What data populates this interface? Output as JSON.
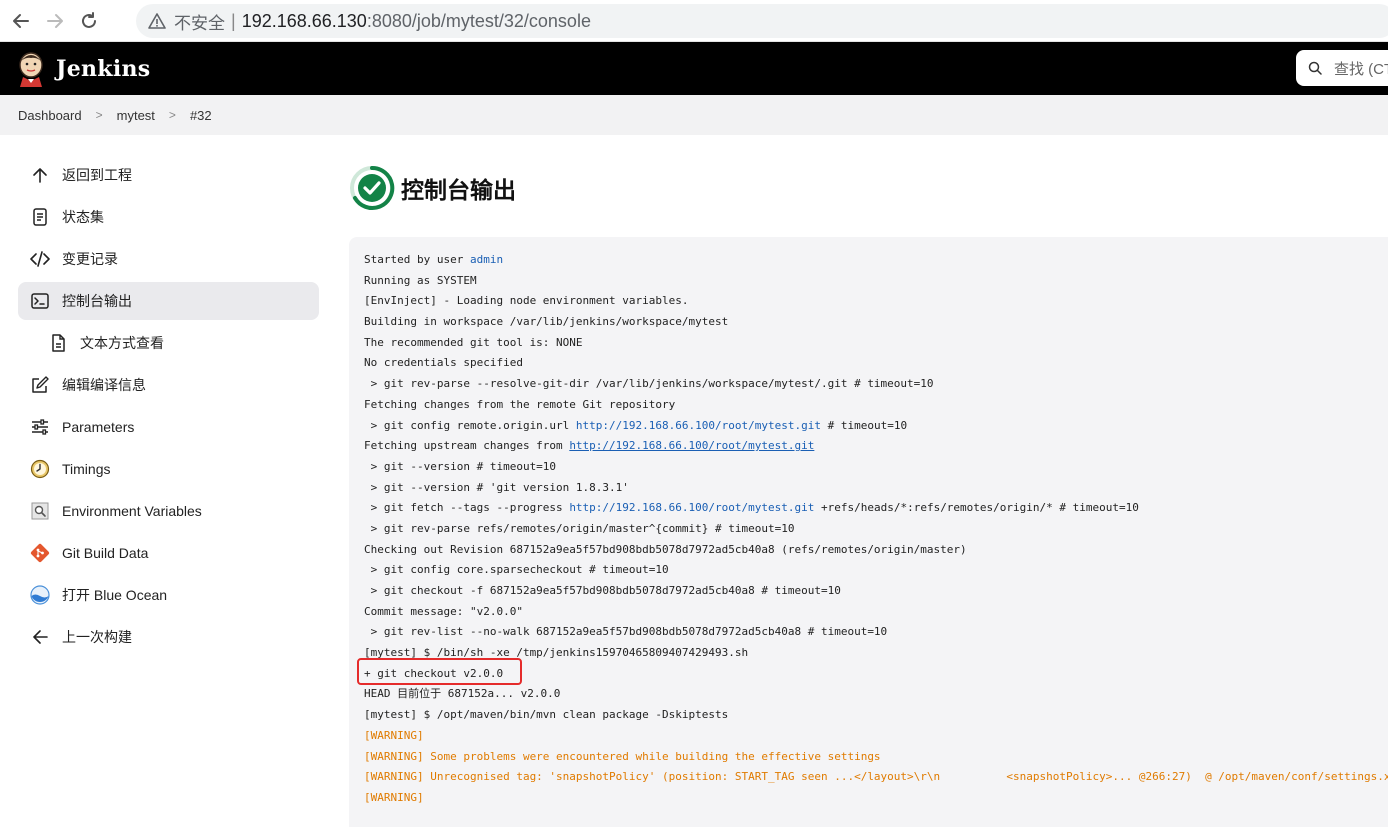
{
  "browser": {
    "back_icon": "back-arrow-icon",
    "forward_icon": "forward-arrow-icon",
    "reload_icon": "reload-icon",
    "security_label": "不安全",
    "separator": "|",
    "url_host": "192.168.66.130",
    "url_rest": ":8080/job/mytest/32/console"
  },
  "header": {
    "title": "Jenkins",
    "search_placeholder": "查找 (CT"
  },
  "breadcrumb": {
    "items": [
      "Dashboard",
      "mytest",
      "#32"
    ]
  },
  "sidebar": {
    "items": [
      {
        "label": "返回到工程",
        "icon": "arrow-up-icon"
      },
      {
        "label": "状态集",
        "icon": "document-icon"
      },
      {
        "label": "变更记录",
        "icon": "code-icon"
      },
      {
        "label": "控制台输出",
        "icon": "terminal-icon"
      },
      {
        "label": "文本方式查看",
        "icon": "file-icon"
      },
      {
        "label": "编辑编译信息",
        "icon": "edit-icon"
      },
      {
        "label": "Parameters",
        "icon": "sliders-icon"
      },
      {
        "label": "Timings",
        "icon": "clock-icon"
      },
      {
        "label": "Environment Variables",
        "icon": "env-icon"
      },
      {
        "label": "Git Build Data",
        "icon": "git-icon"
      },
      {
        "label": "打开 Blue Ocean",
        "icon": "blue-ocean-icon"
      },
      {
        "label": "上一次构建",
        "icon": "arrow-left-icon"
      }
    ]
  },
  "main": {
    "title": "控制台输出",
    "status_icon": "success-check-icon"
  },
  "console": {
    "l1_prefix": "Started by user ",
    "l1_link": "admin",
    "l2": "Running as SYSTEM",
    "l3": "[EnvInject] - Loading node environment variables.",
    "l4": "Building in workspace /var/lib/jenkins/workspace/mytest",
    "l5": "The recommended git tool is: NONE",
    "l6": "No credentials specified",
    "l7": " > git rev-parse --resolve-git-dir /var/lib/jenkins/workspace/mytest/.git # timeout=10",
    "l8": "Fetching changes from the remote Git repository",
    "l9_prefix": " > git config remote.origin.url ",
    "l9_link": "http://192.168.66.100/root/mytest.git",
    "l9_suffix": " # timeout=10",
    "l10_prefix": "Fetching upstream changes from ",
    "l10_link": "http://192.168.66.100/root/mytest.git",
    "l11": " > git --version # timeout=10",
    "l12": " > git --version # 'git version 1.8.3.1'",
    "l13_prefix": " > git fetch --tags --progress ",
    "l13_link": "http://192.168.66.100/root/mytest.git",
    "l13_suffix": " +refs/heads/*:refs/remotes/origin/* # timeout=10",
    "l14": " > git rev-parse refs/remotes/origin/master^{commit} # timeout=10",
    "l15": "Checking out Revision 687152a9ea5f57bd908bdb5078d7972ad5cb40a8 (refs/remotes/origin/master)",
    "l16": " > git config core.sparsecheckout # timeout=10",
    "l17": " > git checkout -f 687152a9ea5f57bd908bdb5078d7972ad5cb40a8 # timeout=10",
    "l18": "Commit message: \"v2.0.0\"",
    "l19": " > git rev-list --no-walk 687152a9ea5f57bd908bdb5078d7972ad5cb40a8 # timeout=10",
    "l20": "[mytest] $ /bin/sh -xe /tmp/jenkins15970465809407429493.sh",
    "l21": "+ git checkout v2.0.0",
    "l22": "HEAD 目前位于 687152a... v2.0.0",
    "l23": "[mytest] $ /opt/maven/bin/mvn clean package -Dskiptests",
    "l24": "[WARNING]",
    "l25": "[WARNING] Some problems were encountered while building the effective settings",
    "l26": "[WARNING] Unrecognised tag: 'snapshotPolicy' (position: START_TAG seen ...</layout>\\r\\n          <snapshotPolicy>... @266:27)  @ /opt/maven/conf/settings.x",
    "l27": "[WARNING]"
  },
  "colors": {
    "link": "#1a5fb4",
    "warning": "#e07b00",
    "highlight": "#e52b2b",
    "success": "#138347"
  }
}
